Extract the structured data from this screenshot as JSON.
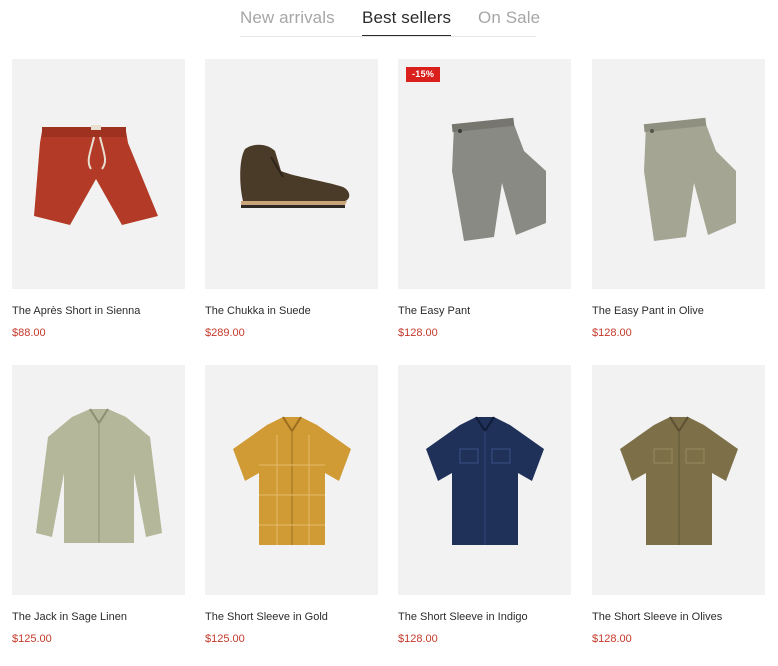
{
  "tabs": [
    {
      "label": "New arrivals",
      "active": false
    },
    {
      "label": "Best sellers",
      "active": true
    },
    {
      "label": "On Sale",
      "active": false
    }
  ],
  "products": [
    {
      "title": "The Après Short in Sienna",
      "price": "$88.00",
      "badge": null,
      "image": "red-shorts",
      "color": "#b23a26"
    },
    {
      "title": "The Chukka in Suede",
      "price": "$289.00",
      "badge": null,
      "image": "brown-suede-boot",
      "color": "#4a3b28"
    },
    {
      "title": "The Easy Pant",
      "price": "$128.00",
      "badge": "-15%",
      "image": "grey-pants",
      "color": "#8a8a84"
    },
    {
      "title": "The Easy Pant in Olive",
      "price": "$128.00",
      "badge": null,
      "image": "olive-pants",
      "color": "#a5a594"
    },
    {
      "title": "The Jack in Sage Linen",
      "price": "$125.00",
      "badge": null,
      "image": "sage-long-sleeve-shirt",
      "color": "#b4b799"
    },
    {
      "title": "The Short Sleeve in Gold",
      "price": "$125.00",
      "badge": null,
      "image": "gold-short-sleeve-shirt",
      "color": "#d09a35"
    },
    {
      "title": "The Short Sleeve in Indigo",
      "price": "$128.00",
      "badge": null,
      "image": "indigo-short-sleeve-shirt",
      "color": "#1f3159"
    },
    {
      "title": "The Short Sleeve in Olives",
      "price": "$128.00",
      "badge": null,
      "image": "olive-short-sleeve-shirt",
      "color": "#7d7048"
    }
  ]
}
